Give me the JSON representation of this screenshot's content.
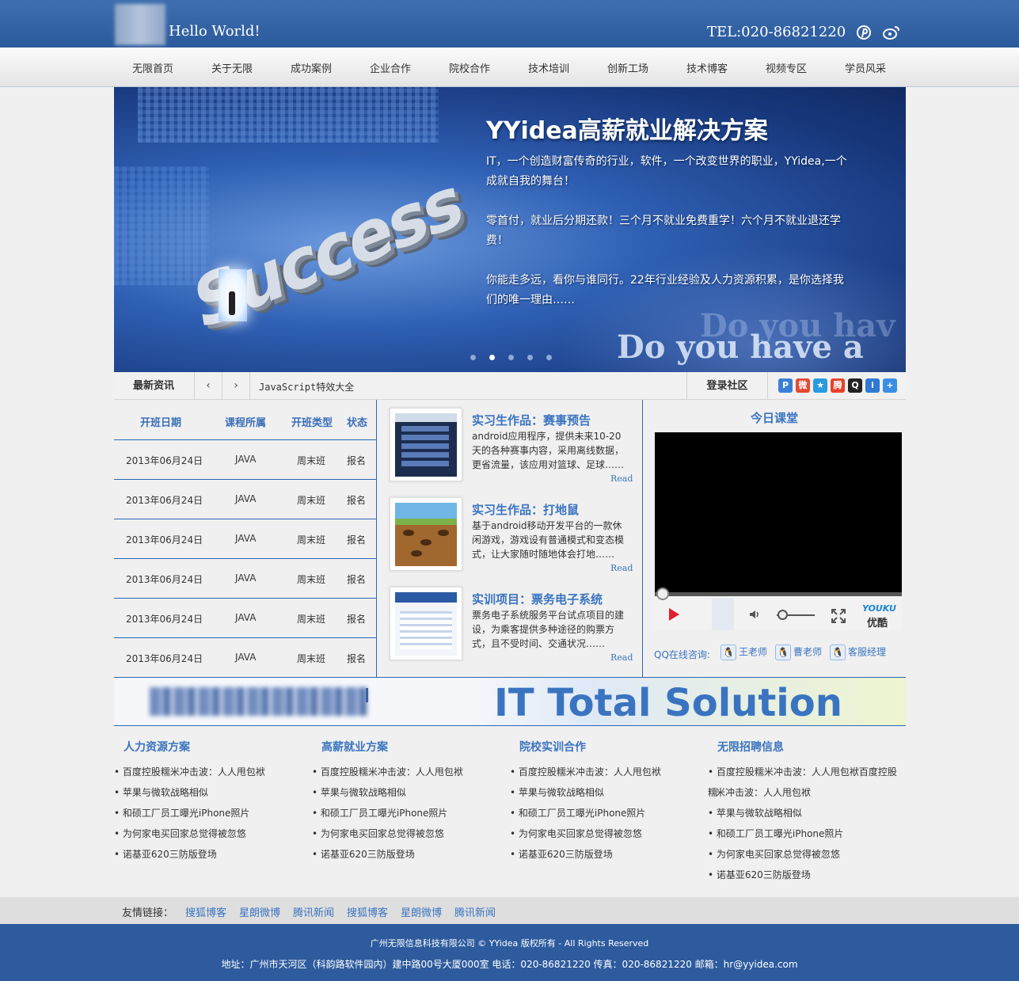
{
  "header": {
    "greeting": "Hello World!",
    "tel": "TEL:020-86821220",
    "icons": [
      "pinterest-icon",
      "weibo-icon"
    ]
  },
  "nav": {
    "items": [
      "无限首页",
      "关于无限",
      "成功案例",
      "企业合作",
      "院校合作",
      "技术培训",
      "创新工场",
      "技术博客",
      "视频专区",
      "学员风采"
    ]
  },
  "banner": {
    "title": "YYidea高薪就业解决方案",
    "p1": "IT，一个创造财富传奇的行业，软件，一个改变世界的职业，YYidea,一个成就自我的舞台！",
    "p2": "零首付，就业后分期还款！三个月不就业免费重学！六个月不就业退还学费！",
    "p3": "你能走多远，看你与谁同行。22年行业经验及人力资源积累，是你选择我们的唯一理由……",
    "img_text1": "Success",
    "img_text2": "Do you have a",
    "img_text3": "Do you hav"
  },
  "newsbar": {
    "label": "最新资讯",
    "prev": "‹",
    "next": "›",
    "ticker": "JavaScript特效大全",
    "login": "登录社区"
  },
  "classes": {
    "headers": [
      "开班日期",
      "课程所属",
      "开班类型",
      "状态"
    ],
    "rows": [
      [
        "2013年06月24日",
        "JAVA",
        "周末班",
        "报名"
      ],
      [
        "2013年06月24日",
        "JAVA",
        "周末班",
        "报名"
      ],
      [
        "2013年06月24日",
        "JAVA",
        "周末班",
        "报名"
      ],
      [
        "2013年06月24日",
        "JAVA",
        "周末班",
        "报名"
      ],
      [
        "2013年06月24日",
        "JAVA",
        "周末班",
        "报名"
      ],
      [
        "2013年06月24日",
        "JAVA",
        "周末班",
        "报名"
      ]
    ]
  },
  "works": [
    {
      "title": "实习生作品：赛事预告",
      "desc": "android应用程序，提供未来10-20天的各种赛事内容，采用离线数据，更省流量，该应用对篮球、足球……",
      "read": "Read"
    },
    {
      "title": "实习生作品：打地鼠",
      "desc": "基于android移动开发平台的一款休闲游戏，游戏设有普通模式和变态模式，让大家随时随地体会打地……",
      "read": "Read"
    },
    {
      "title": "实训项目：票务电子系统",
      "desc": "票务电子系统服务平台试点项目的建设，为乘客提供多种途径的购票方式，且不受时间、交通状况……",
      "read": "Read"
    }
  ],
  "today": {
    "title": "今日课堂",
    "youku1": "YOUKU",
    "youku2": "优酷",
    "qq_label": "QQ在线咨询:",
    "qq_people": [
      "王老师",
      "曹老师",
      "客服经理"
    ]
  },
  "it_banner": {
    "text": "IT Total Solution"
  },
  "columns": [
    {
      "title": "人力资源方案",
      "items": [
        "百度控股糯米冲击波：人人甩包袱",
        "苹果与微软战略相似",
        "和硕工厂员工曝光iPhone照片",
        "为何家电买回家总觉得被忽悠",
        "诺基亚620三防版登场"
      ]
    },
    {
      "title": "高薪就业方案",
      "items": [
        "百度控股糯米冲击波：人人甩包袱",
        "苹果与微软战略相似",
        "和硕工厂员工曝光iPhone照片",
        "为何家电买回家总觉得被忽悠",
        "诺基亚620三防版登场"
      ]
    },
    {
      "title": "院校实训合作",
      "items": [
        "百度控股糯米冲击波：人人甩包袱",
        "苹果与微软战略相似",
        "和硕工厂员工曝光iPhone照片",
        "为何家电买回家总觉得被忽悠",
        "诺基亚620三防版登场"
      ]
    },
    {
      "title": "无限招聘信息",
      "items": [
        "百度控股糯米冲击波：人人甩包袱百度控股糯",
        "米冲击波：人人甩包袱",
        "苹果与微软战略相似",
        "和硕工厂员工曝光iPhone照片",
        "为何家电买回家总觉得被忽悠",
        "诺基亚620三防版登场"
      ]
    }
  ],
  "links": {
    "label": "友情链接：",
    "items": [
      "搜狐博客",
      "星朗微博",
      "腾讯新闻",
      "搜狐博客",
      "星朗微博",
      "腾讯新闻"
    ]
  },
  "footer": {
    "line1": "广州无限信息科技有限公司 © YYidea 版权所有 - All Rights Reserved",
    "line2": "地址：广州市天河区（科韵路软件园内）建中路00号大厦000室 电话：020-86821220 传真：020-86821220 邮箱：hr@yyidea.com"
  },
  "colors": {
    "brand": "#2d5b9e",
    "accent": "#3a74c0",
    "line": "#2a67b4"
  }
}
